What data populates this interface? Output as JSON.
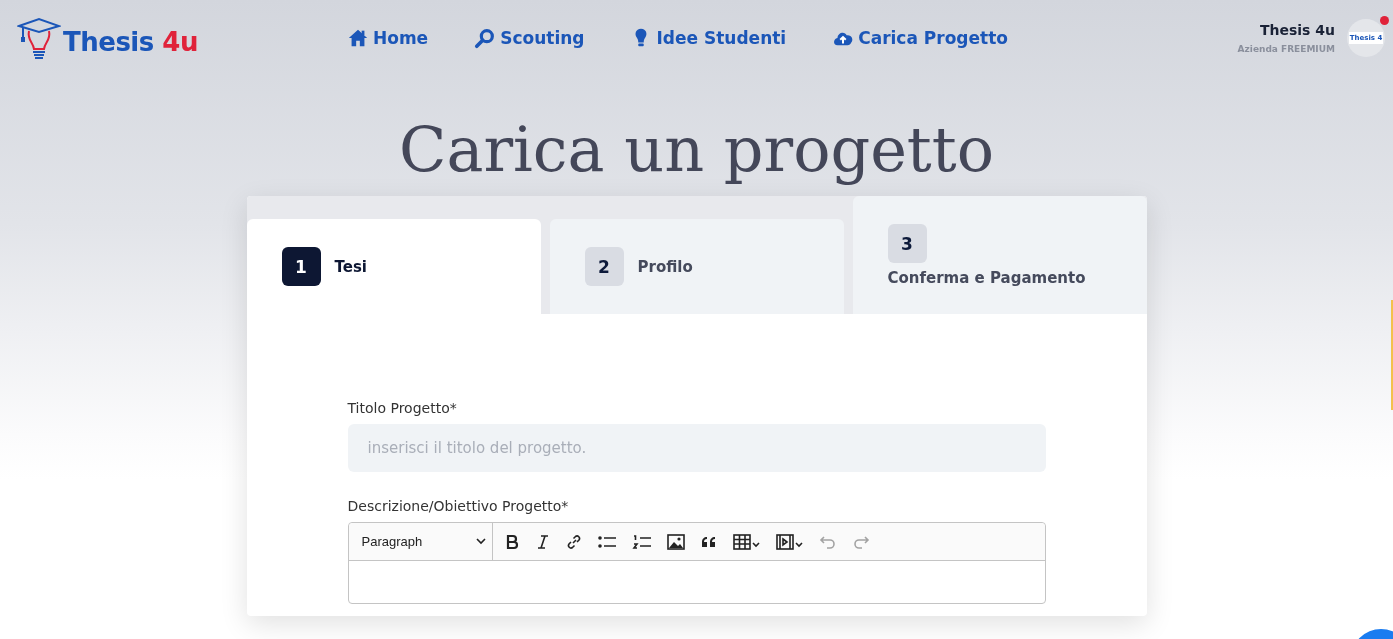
{
  "header": {
    "logo": {
      "word": "Thesis",
      "accent": "4u"
    },
    "nav": [
      {
        "kind": "home",
        "label": "Home"
      },
      {
        "kind": "search",
        "label": "Scouting"
      },
      {
        "kind": "bulb",
        "label": "Idee Studenti"
      },
      {
        "kind": "upload",
        "label": "Carica Progetto"
      }
    ],
    "user": {
      "name": "Thesis 4u",
      "plan": "Azienda FREEMIUM",
      "avatar_text": "Thesis 4",
      "notification": true
    }
  },
  "page_title": "Carica un progetto",
  "steps": [
    {
      "number": "1",
      "label": "Tesi",
      "selected": true,
      "hovered": false
    },
    {
      "number": "2",
      "label": "Profilo",
      "selected": false,
      "hovered": false
    },
    {
      "number": "3",
      "label": "Conferma e Pagamento",
      "selected": false,
      "hovered": true
    }
  ],
  "form": {
    "title_label": "Titolo Progetto*",
    "title_placeholder": "inserisci il titolo del progetto.",
    "description_label": "Descrizione/Obiettivo Progetto*",
    "editor": {
      "format": "Paragraph",
      "buttons": [
        {
          "kind": "bold",
          "disabled": false
        },
        {
          "kind": "italic",
          "disabled": false
        },
        {
          "kind": "link",
          "disabled": false
        },
        {
          "kind": "bullets",
          "disabled": false
        },
        {
          "kind": "numbers",
          "disabled": false
        },
        {
          "kind": "image",
          "disabled": false
        },
        {
          "kind": "quote",
          "disabled": false
        },
        {
          "kind": "table",
          "disabled": false
        },
        {
          "kind": "media",
          "disabled": false
        },
        {
          "kind": "undo",
          "disabled": true
        },
        {
          "kind": "redo",
          "disabled": true
        }
      ]
    }
  }
}
